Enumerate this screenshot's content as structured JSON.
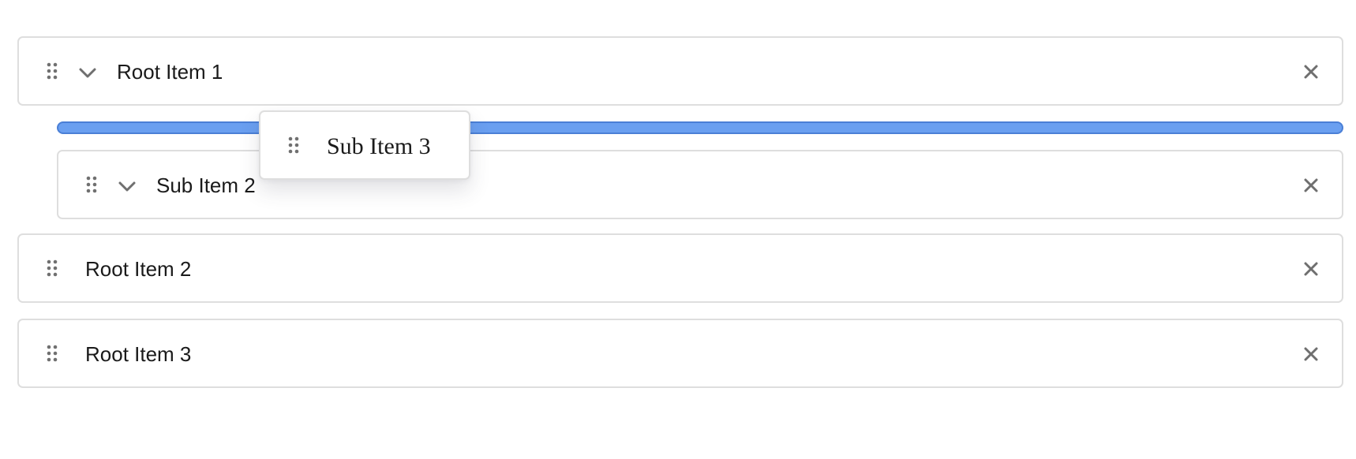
{
  "tree": {
    "items": [
      {
        "label": "Root Item 1",
        "icon": "chevron-down-icon",
        "expanded": true
      },
      {
        "label": "Sub Item 2",
        "icon": "chevron-down-icon",
        "expanded": true
      },
      {
        "label": "Root Item 2"
      },
      {
        "label": "Root Item 3"
      }
    ],
    "dragging": {
      "label": "Sub Item 3"
    }
  },
  "icons": {
    "handle": "drag-handle-icon",
    "remove": "close-icon"
  },
  "colors": {
    "drop_indicator": "#6a9ff0",
    "drop_indicator_border": "#4a7fd6",
    "border": "#dedede",
    "icon": "#6f6f6f",
    "text": "#1a1a1a"
  }
}
